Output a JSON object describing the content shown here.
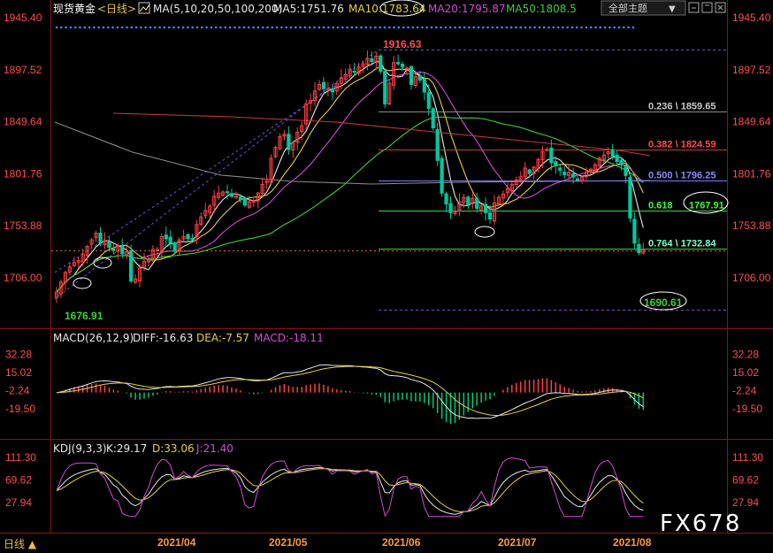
{
  "header": {
    "title": "现货黄金",
    "period": "<日线>",
    "ma_label": "MA(5,10,20,50,100,200)",
    "ma5": "MA5:1751.76",
    "ma10": "MA10:1783.64",
    "ma20": "MA20:1795.87",
    "ma50": "MA50:1808.5",
    "theme_button": "全部主题",
    "colors": {
      "ma5": "#e8e8e8",
      "ma10": "#e6d23c",
      "ma20": "#d44ad8",
      "ma50": "#3ccf3c",
      "ma100": "#7f7f7f",
      "ma200": "#c23a3a"
    }
  },
  "price_axis": {
    "ticks": [
      "1945.40",
      "1897.52",
      "1849.64",
      "1801.76",
      "1753.88",
      "1706.00"
    ]
  },
  "annotations": {
    "high": "1916.63",
    "low_mar": "1676.91",
    "low_aug": "1690.61",
    "fib": [
      {
        "label": "0.236 \\ 1859.65",
        "color": "#c8c8c8"
      },
      {
        "label": "0.382 \\ 1824.59",
        "color": "#ff4c4c"
      },
      {
        "label": "0.500 \\ 1796.25",
        "color": "#8a8aff"
      },
      {
        "label": "0.618",
        "value": "1767.91",
        "color": "#3cff3c"
      },
      {
        "label": "0.764 \\ 1732.84",
        "color": "#7fffd4"
      }
    ]
  },
  "macd": {
    "title": "MACD(26,12,9)",
    "diff": "DIFF:-16.63",
    "dea": "DEA:-7.57",
    "macd": "MACD:-18.11",
    "ticks": [
      "32.28",
      "15.02",
      "-2.24",
      "-19.50"
    ]
  },
  "kdj": {
    "title": "KDJ(9,3,3)",
    "k": "K:29.17",
    "d": "D:33.06",
    "j": "J:21.40",
    "ticks": [
      "111.30",
      "69.62",
      "27.94"
    ]
  },
  "xaxis": {
    "labels": [
      "2021/04",
      "2021/05",
      "2021/06",
      "2021/07",
      "2021/08"
    ]
  },
  "footer": {
    "period": "日线 ▲",
    "watermark": "FX678"
  },
  "chart_data": {
    "type": "candlestick",
    "title": "现货黄金 日线",
    "ylim": [
      1676,
      1945.4
    ],
    "closes": [
      1693,
      1702,
      1711,
      1716,
      1720,
      1722,
      1728,
      1735,
      1741,
      1747,
      1738,
      1740,
      1734,
      1731,
      1736,
      1728,
      1730,
      1703,
      1705,
      1715,
      1721,
      1723,
      1732,
      1732,
      1744,
      1742,
      1738,
      1731,
      1741,
      1744,
      1742,
      1742,
      1755,
      1762,
      1768,
      1772,
      1781,
      1784,
      1785,
      1785,
      1781,
      1781,
      1778,
      1773,
      1776,
      1777,
      1784,
      1792,
      1795,
      1816,
      1826,
      1836,
      1838,
      1824,
      1830,
      1840,
      1846,
      1866,
      1869,
      1878,
      1884,
      1880,
      1880,
      1877,
      1885,
      1890,
      1893,
      1898,
      1896,
      1900,
      1903,
      1908,
      1905,
      1910,
      1896,
      1866,
      1885,
      1904,
      1903,
      1900,
      1899,
      1884,
      1891,
      1888,
      1877,
      1862,
      1844,
      1814,
      1784,
      1774,
      1766,
      1767,
      1776,
      1780,
      1773,
      1779,
      1770,
      1772,
      1766,
      1760,
      1775,
      1780,
      1783,
      1788,
      1792,
      1796,
      1799,
      1807,
      1802,
      1808,
      1815,
      1822,
      1824,
      1812,
      1809,
      1805,
      1801,
      1803,
      1799,
      1796,
      1799,
      1803,
      1806,
      1810,
      1816,
      1819,
      1822,
      1818,
      1813,
      1810,
      1800,
      1761,
      1738,
      1729,
      1732
    ],
    "markers": {
      "high": 1916.63,
      "low_mar": 1676.91,
      "low_aug": 1690.61
    },
    "fibonacci": [
      {
        "ratio": 0.236,
        "value": 1859.65
      },
      {
        "ratio": 0.382,
        "value": 1824.59
      },
      {
        "ratio": 0.5,
        "value": 1796.25
      },
      {
        "ratio": 0.618,
        "value": 1767.91
      },
      {
        "ratio": 0.764,
        "value": 1732.84
      }
    ],
    "ma": {
      "ma5": 1751.76,
      "ma10": 1783.64,
      "ma20": 1795.87,
      "ma50": 1808.5
    },
    "macd": {
      "diff": -16.63,
      "dea": -7.57,
      "macd": -18.11,
      "ylim": [
        -30,
        40
      ]
    },
    "kdj": {
      "k": 29.17,
      "d": 33.06,
      "j": 21.4,
      "ylim": [
        0,
        125
      ]
    }
  }
}
